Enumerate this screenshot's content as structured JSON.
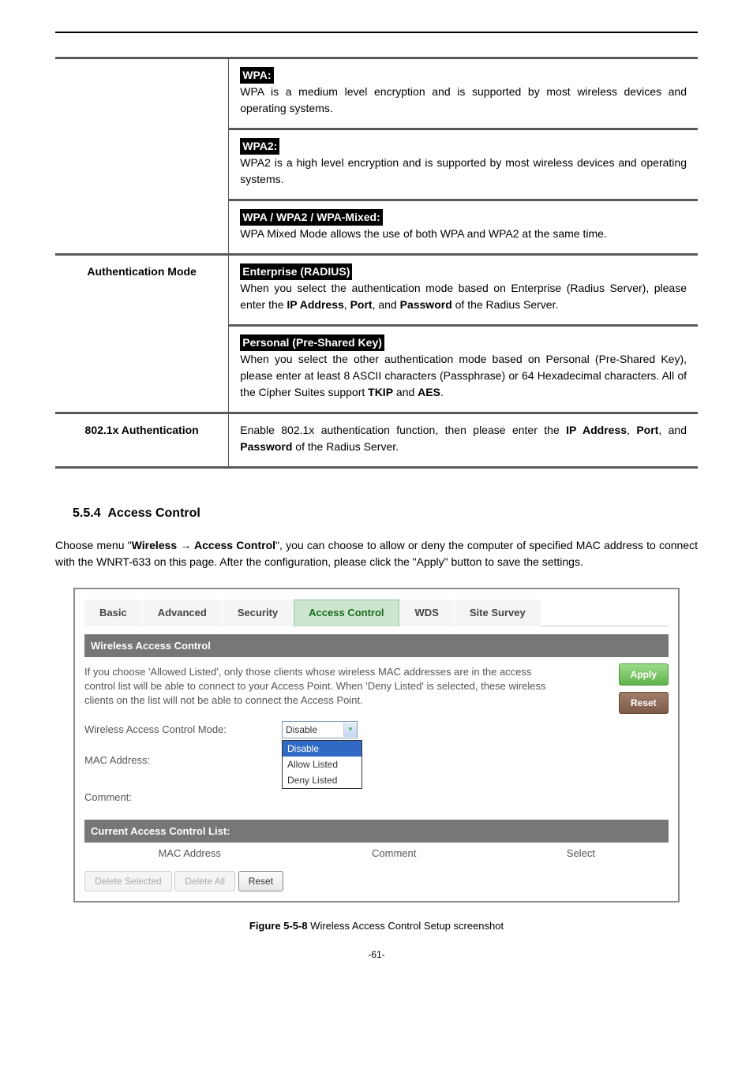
{
  "defs": {
    "wpa": {
      "title": "WPA:",
      "text": "WPA is a medium level encryption and is supported by most wireless devices and operating systems."
    },
    "wpa2": {
      "title": "WPA2:",
      "text": "WPA2 is a high level encryption and is supported by most wireless devices and operating systems."
    },
    "mixed": {
      "title": "WPA / WPA2 / WPA-Mixed:",
      "text": "WPA Mixed Mode allows the use of both WPA and WPA2 at the same time."
    },
    "authmode_label": "Authentication Mode",
    "enterprise": {
      "title": "Enterprise (RADIUS)",
      "text_pre": "When you select the authentication mode based on Enterprise (Radius Server), please enter the ",
      "ip": "IP Address",
      "port": "Port",
      "pass": "Password",
      "text_mid1": ", ",
      "text_mid2": ", and ",
      "text_post": " of the Radius Server."
    },
    "personal": {
      "title": "Personal (Pre-Shared Key)",
      "text_pre": "When you select the other authentication mode based on Personal (Pre-Shared Key), please enter at least 8 ASCII characters (Passphrase) or 64 Hexadecimal characters. All of the Cipher Suites support ",
      "tkip": "TKIP",
      "and": " and ",
      "aes": "AES",
      "dot": "."
    },
    "auth8021x_label": "802.1x Authentication",
    "auth8021x": {
      "text_pre": "Enable 802.1x authentication function, then please enter the ",
      "ip": "IP Address",
      "port": "Port",
      "pass": "Password",
      "text_mid1": ", ",
      "text_mid2": ", and ",
      "text_post": " of the Radius Server."
    }
  },
  "section": {
    "number": "5.5.4",
    "title": "Access Control",
    "para_pre": "Choose menu \"",
    "wireless": "Wireless",
    "arrow": " → ",
    "ac": "Access Control",
    "para_post": "\", you can choose to allow or deny the computer of specified MAC address to connect with the WNRT-633 on this page. After the configuration, please click the \"Apply\" button to save the settings."
  },
  "ui": {
    "tabs": [
      "Basic",
      "Advanced",
      "Security",
      "Access Control",
      "WDS",
      "Site Survey"
    ],
    "panel1": "Wireless Access Control",
    "help": "If you choose 'Allowed Listed', only those clients whose wireless MAC addresses are in the access control list will be able to connect to your Access Point. When 'Deny Listed' is selected, these wireless clients on the list will not be able to connect the Access Point.",
    "apply": "Apply",
    "reset": "Reset",
    "mode_label": "Wireless Access Control Mode:",
    "select_value": "Disable",
    "mac_label": "MAC Address:",
    "comment_label": "Comment:",
    "dropdown": [
      "Disable",
      "Allow Listed",
      "Deny Listed"
    ],
    "panel2": "Current Access Control List:",
    "col1": "MAC Address",
    "col2": "Comment",
    "col3": "Select",
    "del_sel": "Delete Selected",
    "del_all": "Delete All",
    "reset_btn": "Reset"
  },
  "caption_pre": "Figure 5-5-8 ",
  "caption_post": "Wireless Access Control Setup screenshot",
  "pagenum": "-61-"
}
